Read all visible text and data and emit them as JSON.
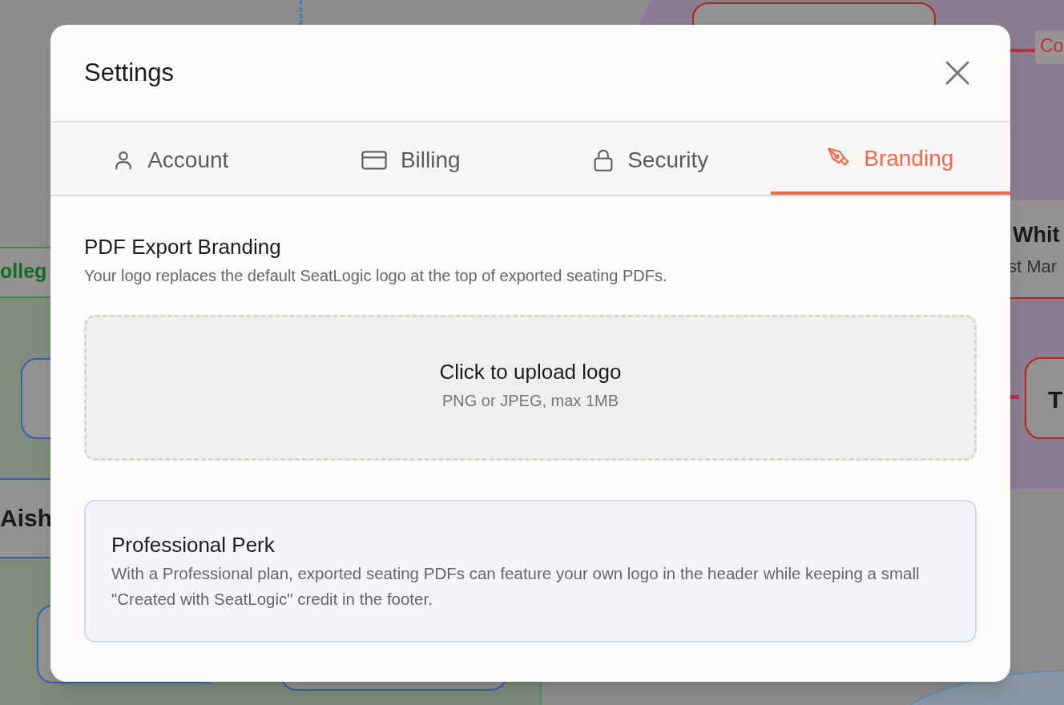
{
  "canvas_labels": [
    "Co",
    "Whit",
    "olleg",
    "st Mar",
    "T",
    "Aish"
  ],
  "dialog": {
    "title": "Settings"
  },
  "tabs": [
    {
      "label": "Account",
      "selected": false
    },
    {
      "label": "Billing",
      "selected": false
    },
    {
      "label": "Security",
      "selected": false
    },
    {
      "label": "Branding",
      "selected": true
    }
  ],
  "section": {
    "title": "PDF Export Branding",
    "description": "Your logo replaces the default SeatLogic logo at the top of exported seating PDFs."
  },
  "upload": {
    "title": "Click to upload logo",
    "hint": "PNG or JPEG, max 1MB"
  },
  "perk": {
    "title": "Professional Perk",
    "text": "With a Professional plan, exported seating PDFs can feature your own logo in the header while keeping a small \"Created with SeatLogic\" credit in the footer."
  }
}
